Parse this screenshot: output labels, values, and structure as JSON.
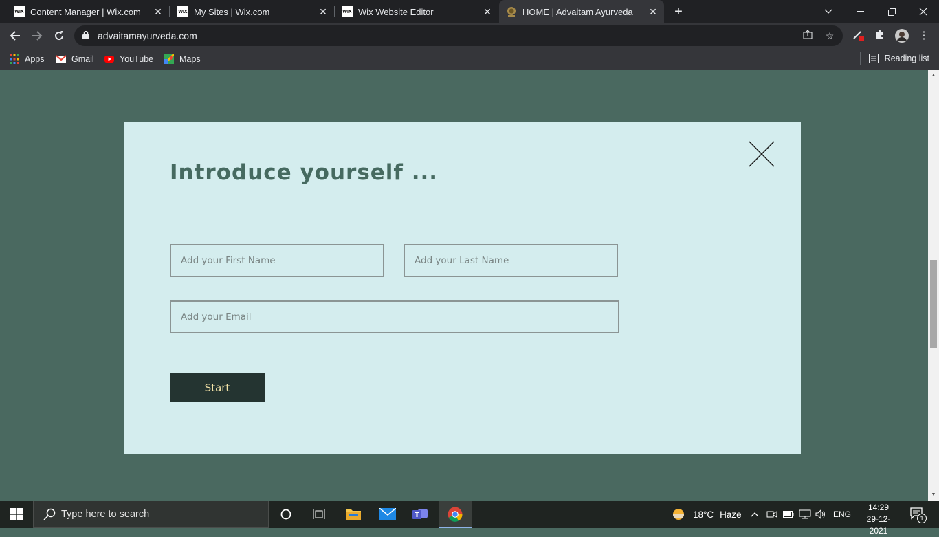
{
  "browser": {
    "tabs": [
      {
        "label": "Content Manager | Wix.com",
        "favicon": "wix-icon"
      },
      {
        "label": "My Sites | Wix.com",
        "favicon": "wix-icon"
      },
      {
        "label": "Wix Website Editor",
        "favicon": "wix-icon"
      },
      {
        "label": "HOME | Advaitam Ayurveda",
        "favicon": "advaitam-logo-icon"
      }
    ],
    "favicon_text": "WIX",
    "new_tab_label": "+",
    "url": "advaitamayurveda.com",
    "bookmarks": [
      {
        "label": "Apps"
      },
      {
        "label": "Gmail"
      },
      {
        "label": "YouTube"
      },
      {
        "label": "Maps"
      }
    ],
    "reading_list": "Reading list"
  },
  "modal": {
    "title": "Introduce yourself ...",
    "first_name_placeholder": "Add your First Name",
    "last_name_placeholder": "Add your Last Name",
    "email_placeholder": "Add your Email",
    "start_label": "Start"
  },
  "taskbar": {
    "search_placeholder": "Type here to search",
    "weather_temp": "18°C",
    "weather_text": "Haze",
    "language": "ENG",
    "time": "14:29",
    "date": "29-12-2021",
    "notification_count": "1"
  },
  "colors": {
    "page_background": "#4a6960",
    "modal_background": "#d4edee",
    "title_color": "#466a60",
    "button_background": "#243431",
    "button_text": "#f3e3a7"
  }
}
